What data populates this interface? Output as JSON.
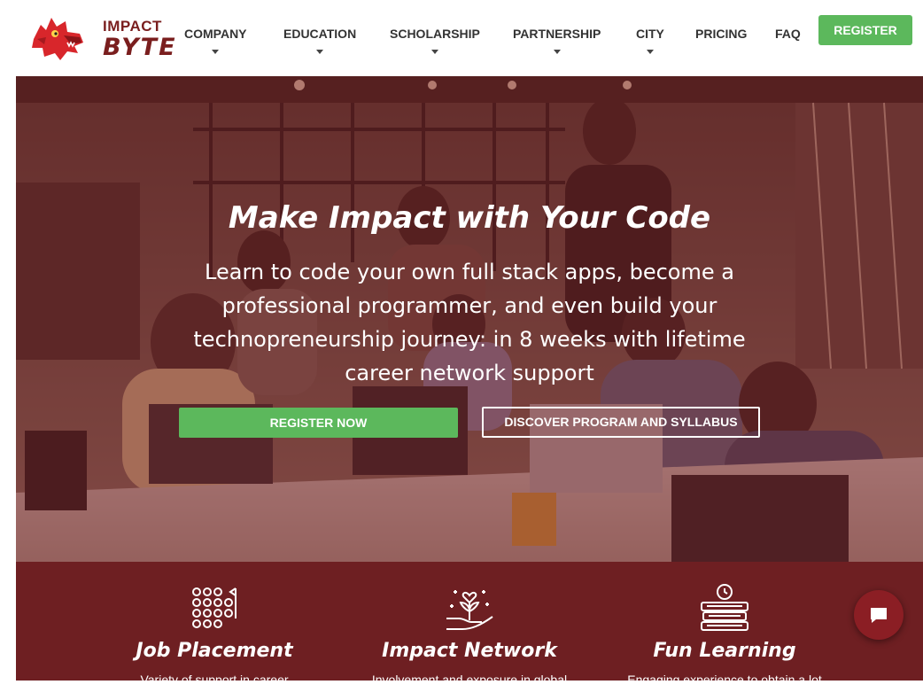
{
  "brand": {
    "line1": "IMPACT",
    "line2": "BYTE"
  },
  "nav": {
    "items": [
      {
        "label": "COMPANY",
        "dropdown": true
      },
      {
        "label": "EDUCATION",
        "dropdown": true
      },
      {
        "label": "SCHOLARSHIP",
        "dropdown": true
      },
      {
        "label": "PARTNERSHIP",
        "dropdown": true
      },
      {
        "label": "CITY",
        "dropdown": true
      },
      {
        "label": "PRICING",
        "dropdown": false
      },
      {
        "label": "FAQ",
        "dropdown": false
      }
    ],
    "register_label": "REGISTER"
  },
  "hero": {
    "title": "Make Impact with Your Code",
    "subtitle": "Learn to code your own full stack apps, become a professional programmer, and even build your technopreneurship journey: in 8 weeks with lifetime career network support",
    "primary_button": "REGISTER NOW",
    "secondary_button": "DISCOVER PROGRAM AND SYLLABUS"
  },
  "features": [
    {
      "title": "Job Placement",
      "description": "Variety of support in career",
      "icon": "people-grid-icon"
    },
    {
      "title": "Impact Network",
      "description": "Involvement and exposure in global",
      "icon": "hand-plant-icon"
    },
    {
      "title": "Fun Learning",
      "description": "Engaging experience to obtain a lot",
      "icon": "books-clock-icon"
    }
  ],
  "colors": {
    "brand_red": "#7a1e1e",
    "green": "#5cb85c",
    "feature_bg": "#6e1f22",
    "chat_bg": "#8b1e24"
  },
  "chat": {
    "icon": "chat-bubble-icon"
  }
}
